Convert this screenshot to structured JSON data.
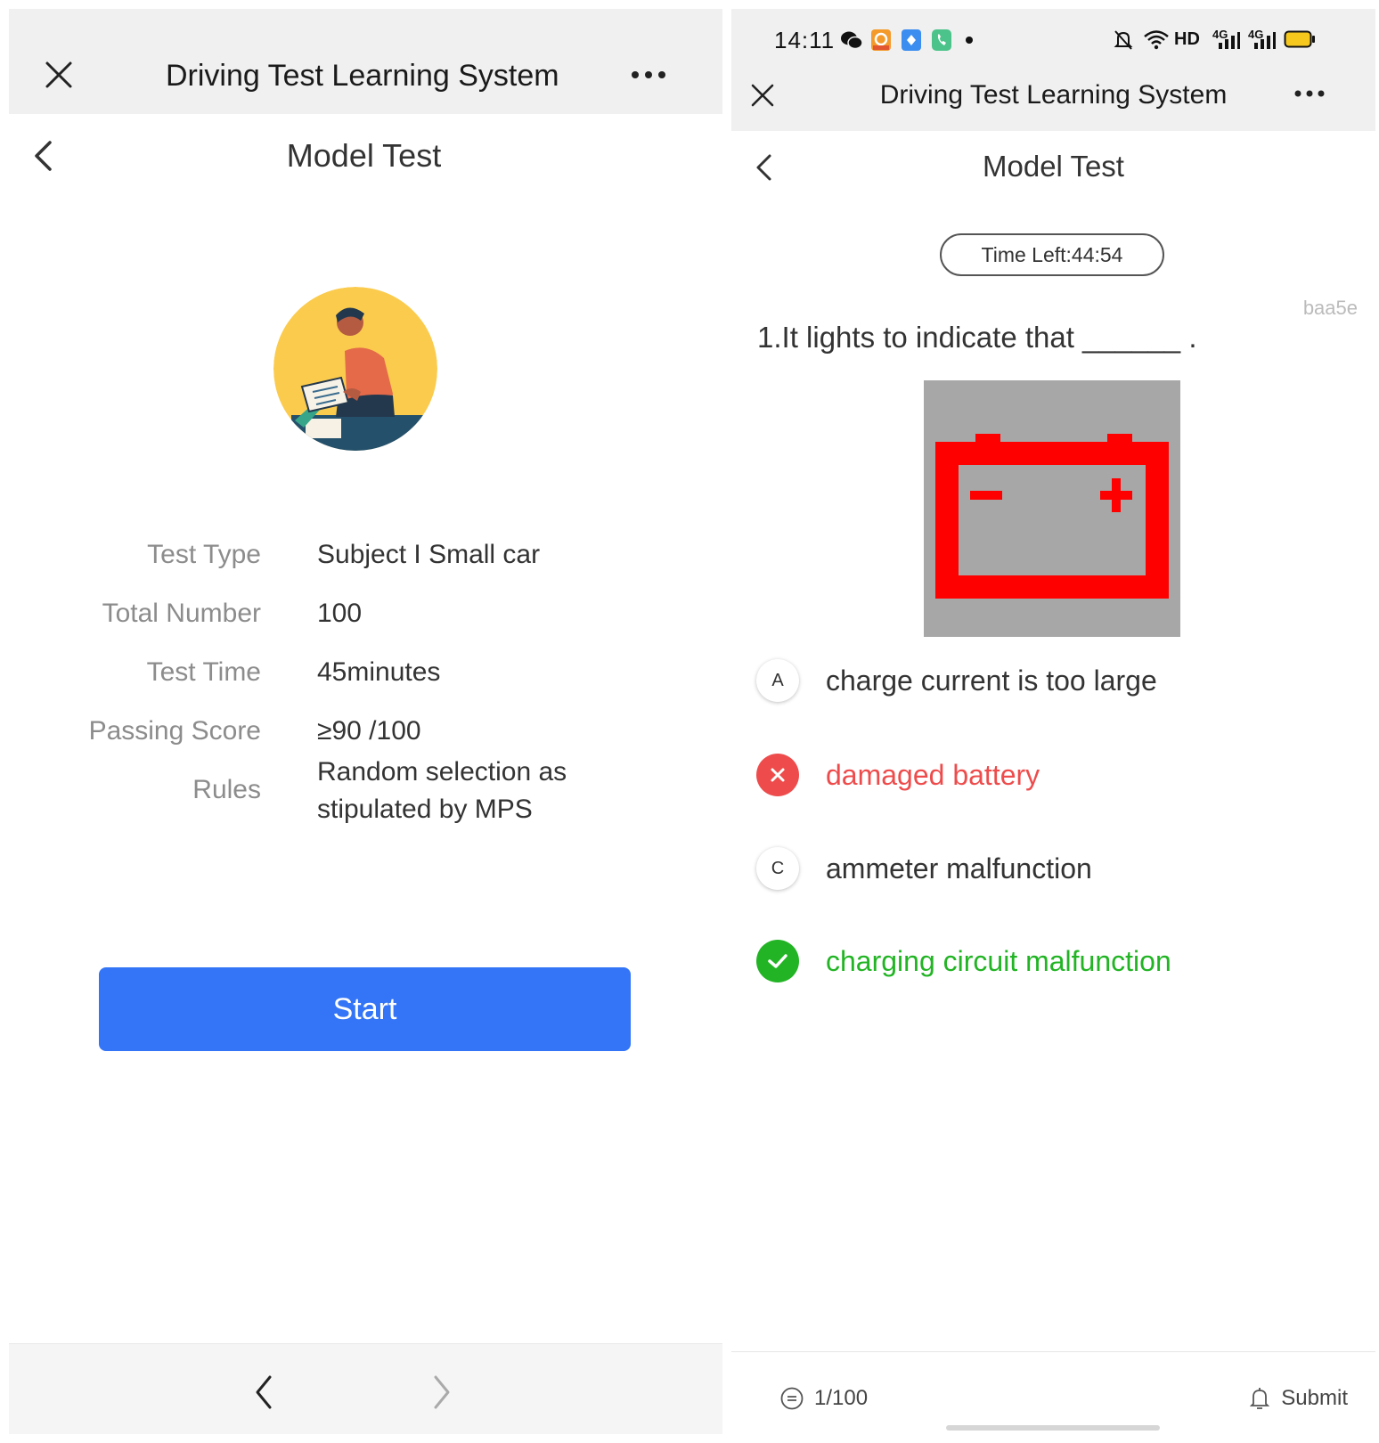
{
  "left_screen": {
    "app_title": "Driving Test Learning System",
    "page_title": "Model Test",
    "info_rows": [
      {
        "label": "Test Type",
        "value": "Subject I Small car"
      },
      {
        "label": "Total Number",
        "value": "100"
      },
      {
        "label": "Test Time",
        "value": "45minutes"
      },
      {
        "label": "Passing Score",
        "value": "≥90 /100"
      },
      {
        "label": "Rules",
        "value": "Random selection as stipulated by MPS"
      }
    ],
    "start_label": "Start",
    "icons": [
      "close-icon",
      "more-icon",
      "back-icon",
      "reader-illustration",
      "nav-back-icon",
      "nav-forward-icon"
    ]
  },
  "right_screen": {
    "status_bar": {
      "time": "14:11",
      "network": "HD",
      "signal_1": "4G",
      "signal_2": "4G",
      "icons": [
        "wechat-icon",
        "app-icon",
        "app-icon",
        "phone-icon",
        "dot-icon",
        "mute-icon",
        "wifi-icon",
        "signal-icon",
        "battery-icon"
      ]
    },
    "app_title": "Driving Test Learning System",
    "page_title": "Model Test",
    "timer": "Time Left:44:54",
    "watermark": "baa5e",
    "question": "1.It lights to indicate that ______ .",
    "image_icon": "battery-warning-icon",
    "options": [
      {
        "badge": "A",
        "text": "charge current is too large",
        "state": "normal"
      },
      {
        "badge": "",
        "text": "damaged battery",
        "state": "wrong"
      },
      {
        "badge": "C",
        "text": "ammeter malfunction",
        "state": "normal"
      },
      {
        "badge": "",
        "text": "charging circuit malfunction",
        "state": "correct"
      }
    ],
    "progress": "1/100",
    "submit_label": "Submit"
  },
  "colors": {
    "primary_blue": "#3375f6",
    "wrong_red": "#ee4c4c",
    "correct_green": "#22b424",
    "battery_red": "#ff0000"
  }
}
